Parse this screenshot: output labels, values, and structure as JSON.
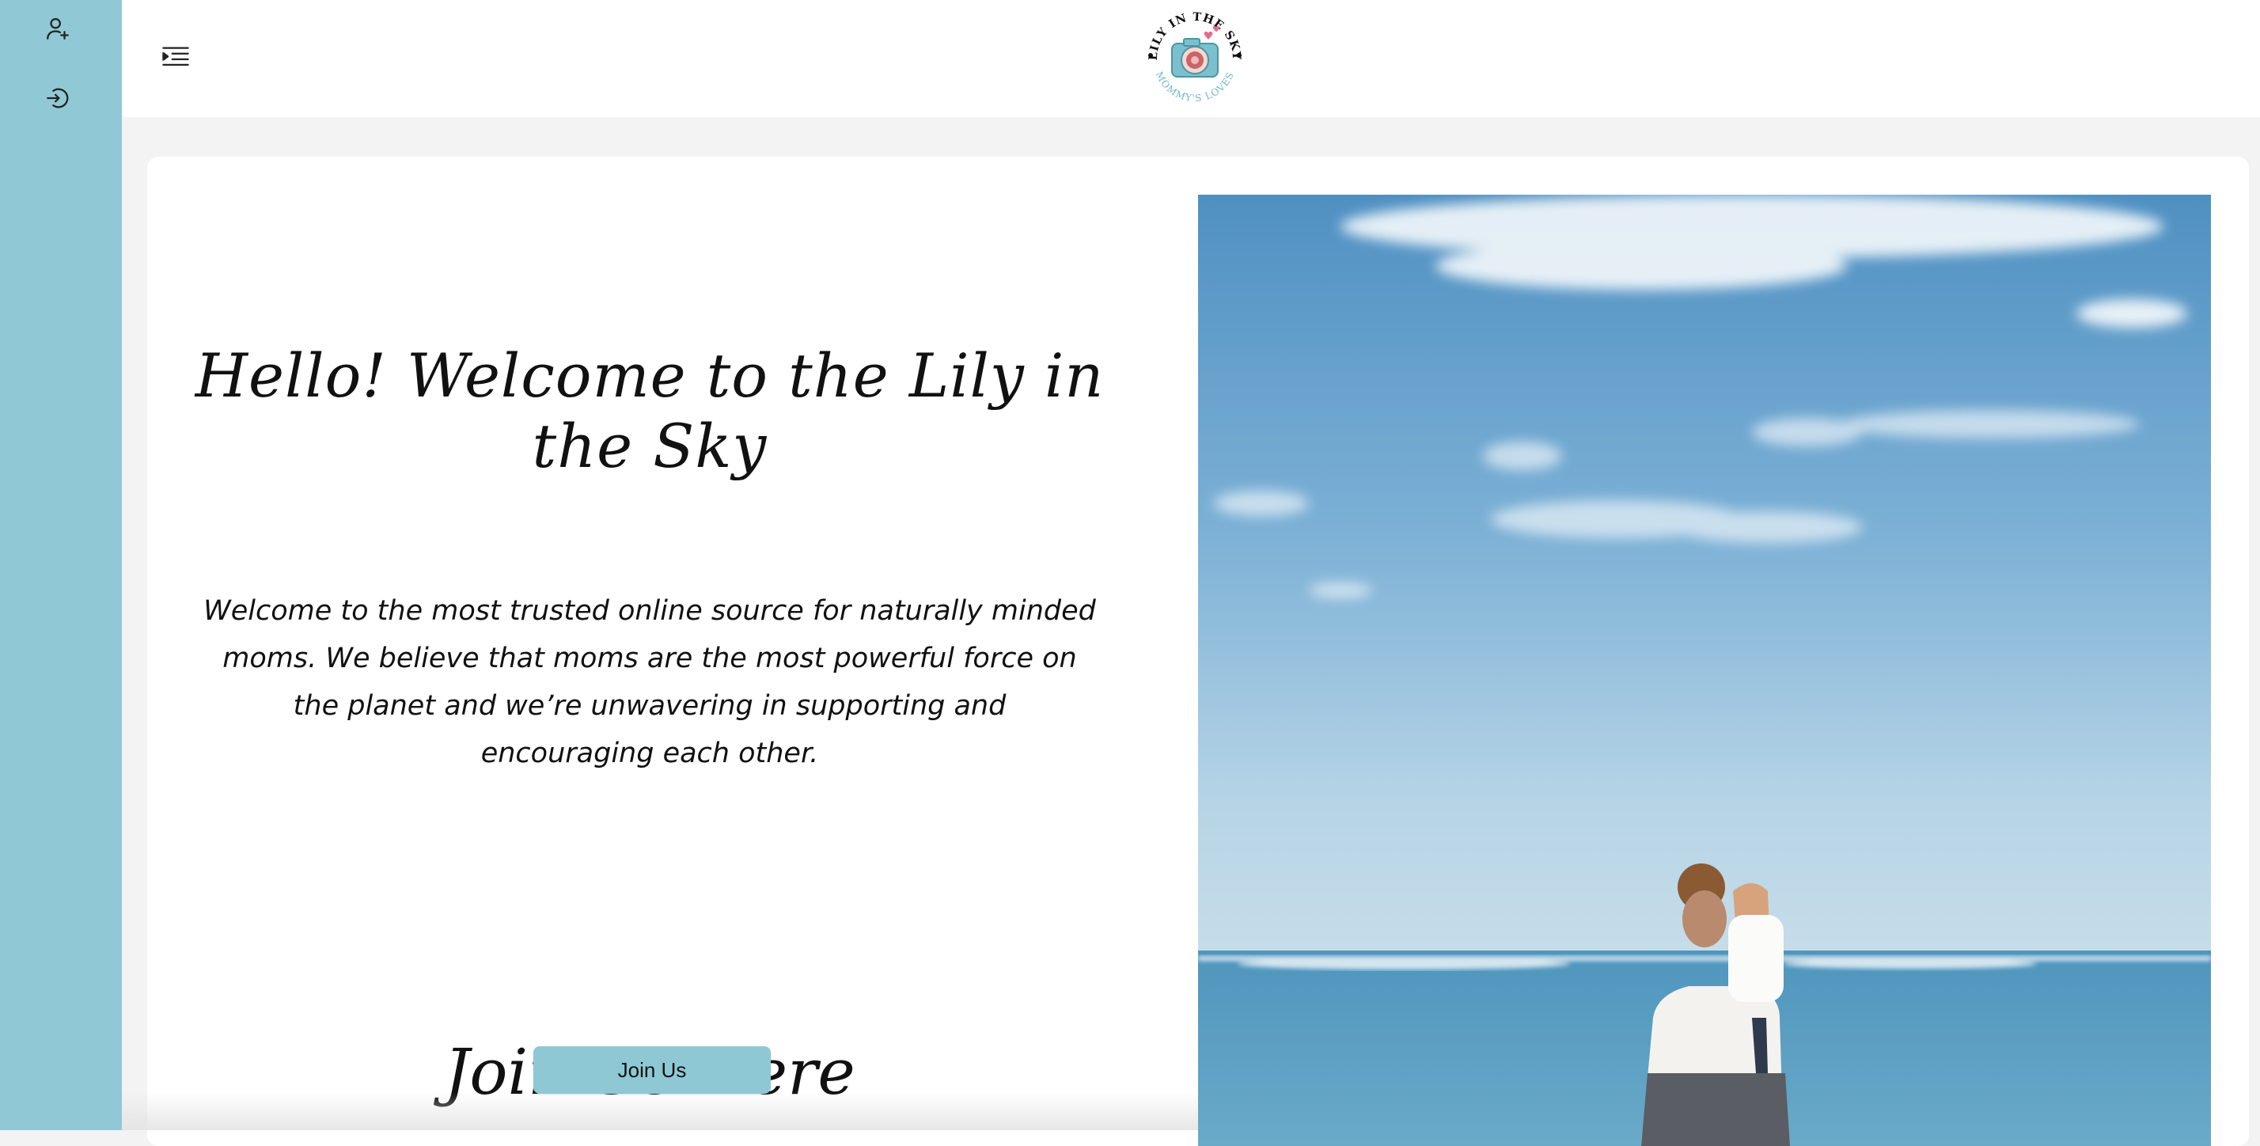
{
  "colors": {
    "sidebar": "#90c9d5",
    "button": "#8ec8d4",
    "page_bg": "#f3f3f3",
    "card_bg": "#ffffff",
    "text": "#111111"
  },
  "sidebar": {
    "items": [
      {
        "icon": "add-user-icon"
      },
      {
        "icon": "logout-icon"
      }
    ]
  },
  "header": {
    "menu_icon": "menu-indent-icon",
    "logo": {
      "top_text": "LILY IN THE SKY",
      "bottom_text": "MOMMY'S LOVES"
    }
  },
  "main": {
    "headline": "Hello! Welcome to the Lily in the Sky",
    "intro": "Welcome to the most trusted online source for naturally minded moms. We believe that moms are the most powerful force on the planet and we’re unwavering in supporting and encouraging each other.",
    "join_heading": "Join Us Here",
    "join_button": "Join Us"
  }
}
